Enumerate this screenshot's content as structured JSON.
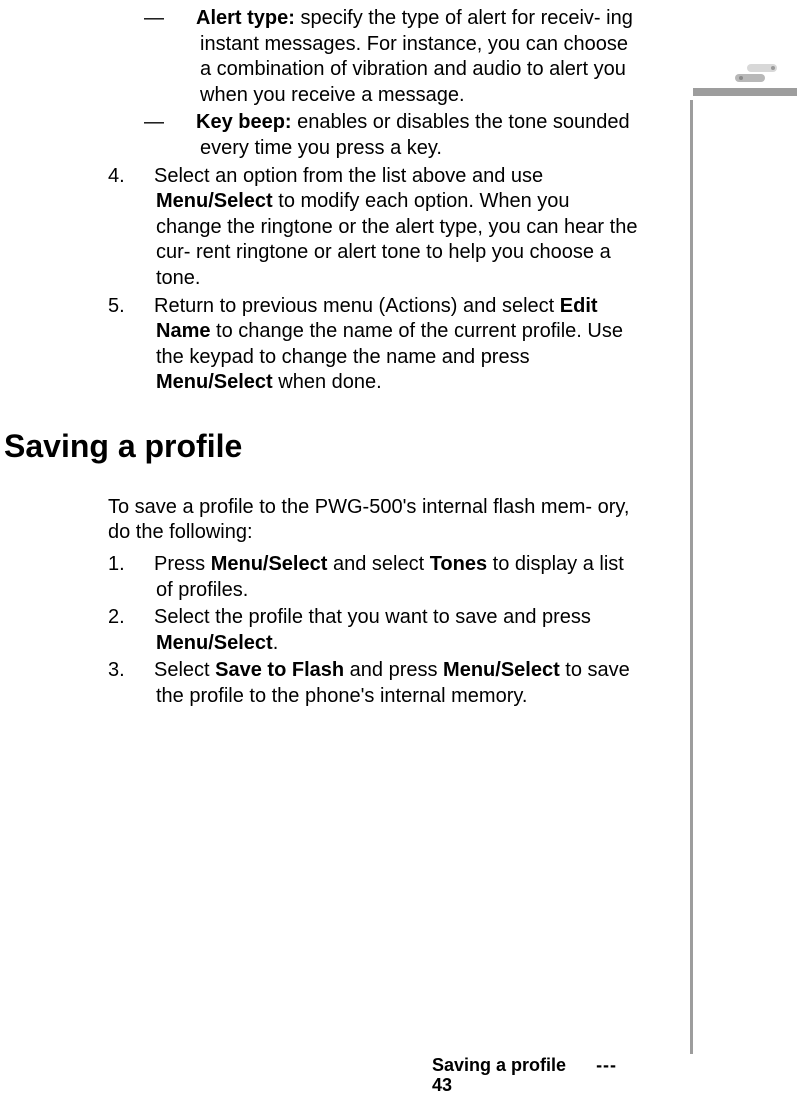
{
  "icon": {
    "name": "phone-tab-icon"
  },
  "carryover": {
    "sub_items": [
      {
        "dash": "—",
        "label": "Alert type:",
        "text": " specify the type of alert for receiv- ing instant messages. For instance, you can choose a combination of vibration and audio to alert you when you receive a message."
      },
      {
        "dash": "—",
        "label": "Key beep:",
        "text": " enables or disables the tone sounded every time you press a key."
      }
    ],
    "numbered": [
      {
        "num": "4.",
        "runs": [
          {
            "t": "Select an option from the list above and use "
          },
          {
            "t": "Menu/Select",
            "b": true
          },
          {
            "t": " to modify each option. When you change the ringtone or the alert type, you can hear the cur- rent ringtone or alert tone to help you choose a tone."
          }
        ]
      },
      {
        "num": "5.",
        "runs": [
          {
            "t": "Return to previous menu (Actions) and select "
          },
          {
            "t": "Edit Name",
            "b": true
          },
          {
            "t": " to change the name of the current profile. Use the keypad to change the name and press "
          },
          {
            "t": "Menu/Select",
            "b": true
          },
          {
            "t": " when done."
          }
        ]
      }
    ]
  },
  "section": {
    "heading": "Saving a profile",
    "intro": "To save a profile to the PWG-500's internal flash mem- ory, do the following:",
    "numbered": [
      {
        "num": "1.",
        "runs": [
          {
            "t": "Press "
          },
          {
            "t": "Menu/Select",
            "b": true
          },
          {
            "t": " and select "
          },
          {
            "t": "Tones",
            "b": true
          },
          {
            "t": " to display a list of profiles."
          }
        ]
      },
      {
        "num": "2.",
        "runs": [
          {
            "t": "Select the profile that you want to save and press "
          },
          {
            "t": "Menu/Select",
            "b": true
          },
          {
            "t": "."
          }
        ]
      },
      {
        "num": "3.",
        "runs": [
          {
            "t": "Select "
          },
          {
            "t": "Save to Flash",
            "b": true
          },
          {
            "t": " and press "
          },
          {
            "t": "Menu/Select",
            "b": true
          },
          {
            "t": " to save the profile to the phone's internal memory."
          }
        ]
      }
    ]
  },
  "footer": {
    "title": "Saving a profile",
    "dashes": "---",
    "page": "43"
  }
}
